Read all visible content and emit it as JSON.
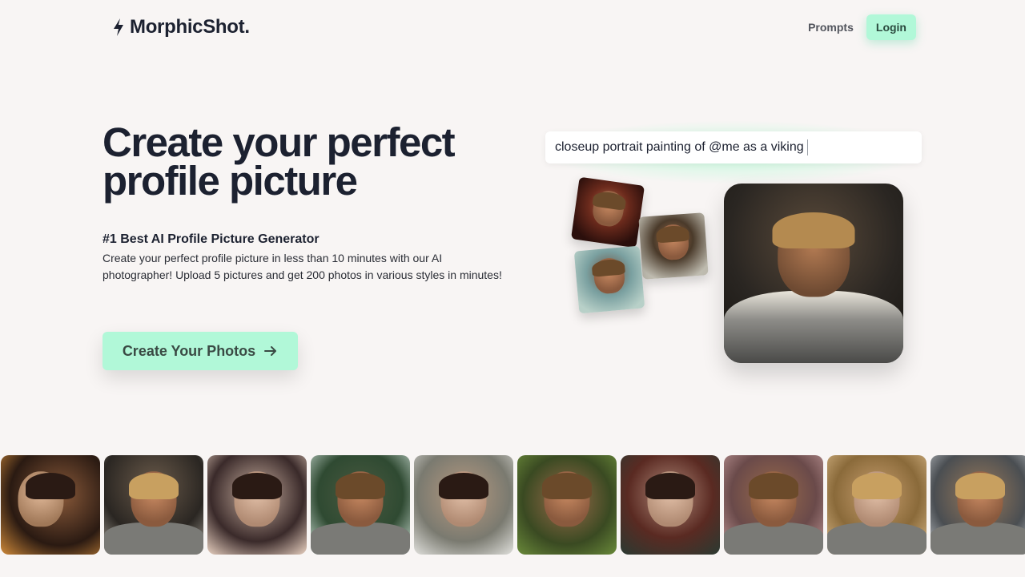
{
  "header": {
    "logo_text": "MorphicShot.",
    "logo_icon": "lightning-bolt-icon",
    "nav": {
      "prompts_label": "Prompts",
      "login_label": "Login"
    }
  },
  "hero": {
    "title": "Create your perfect profile picture",
    "subtitle": "#1 Best AI Profile Picture Generator",
    "description": "Create your perfect profile picture in less than 10 minutes with our AI photographer! Upload 5 pictures and get 200 photos in various styles in minutes!",
    "cta_label": "Create Your Photos",
    "cta_icon": "arrow-right-icon"
  },
  "showcase": {
    "prompt_text": "closeup portrait painting of @me as a viking"
  },
  "colors": {
    "accent": "#b1f8d8",
    "text_dark": "#1c2130",
    "background": "#f8f5f4"
  }
}
